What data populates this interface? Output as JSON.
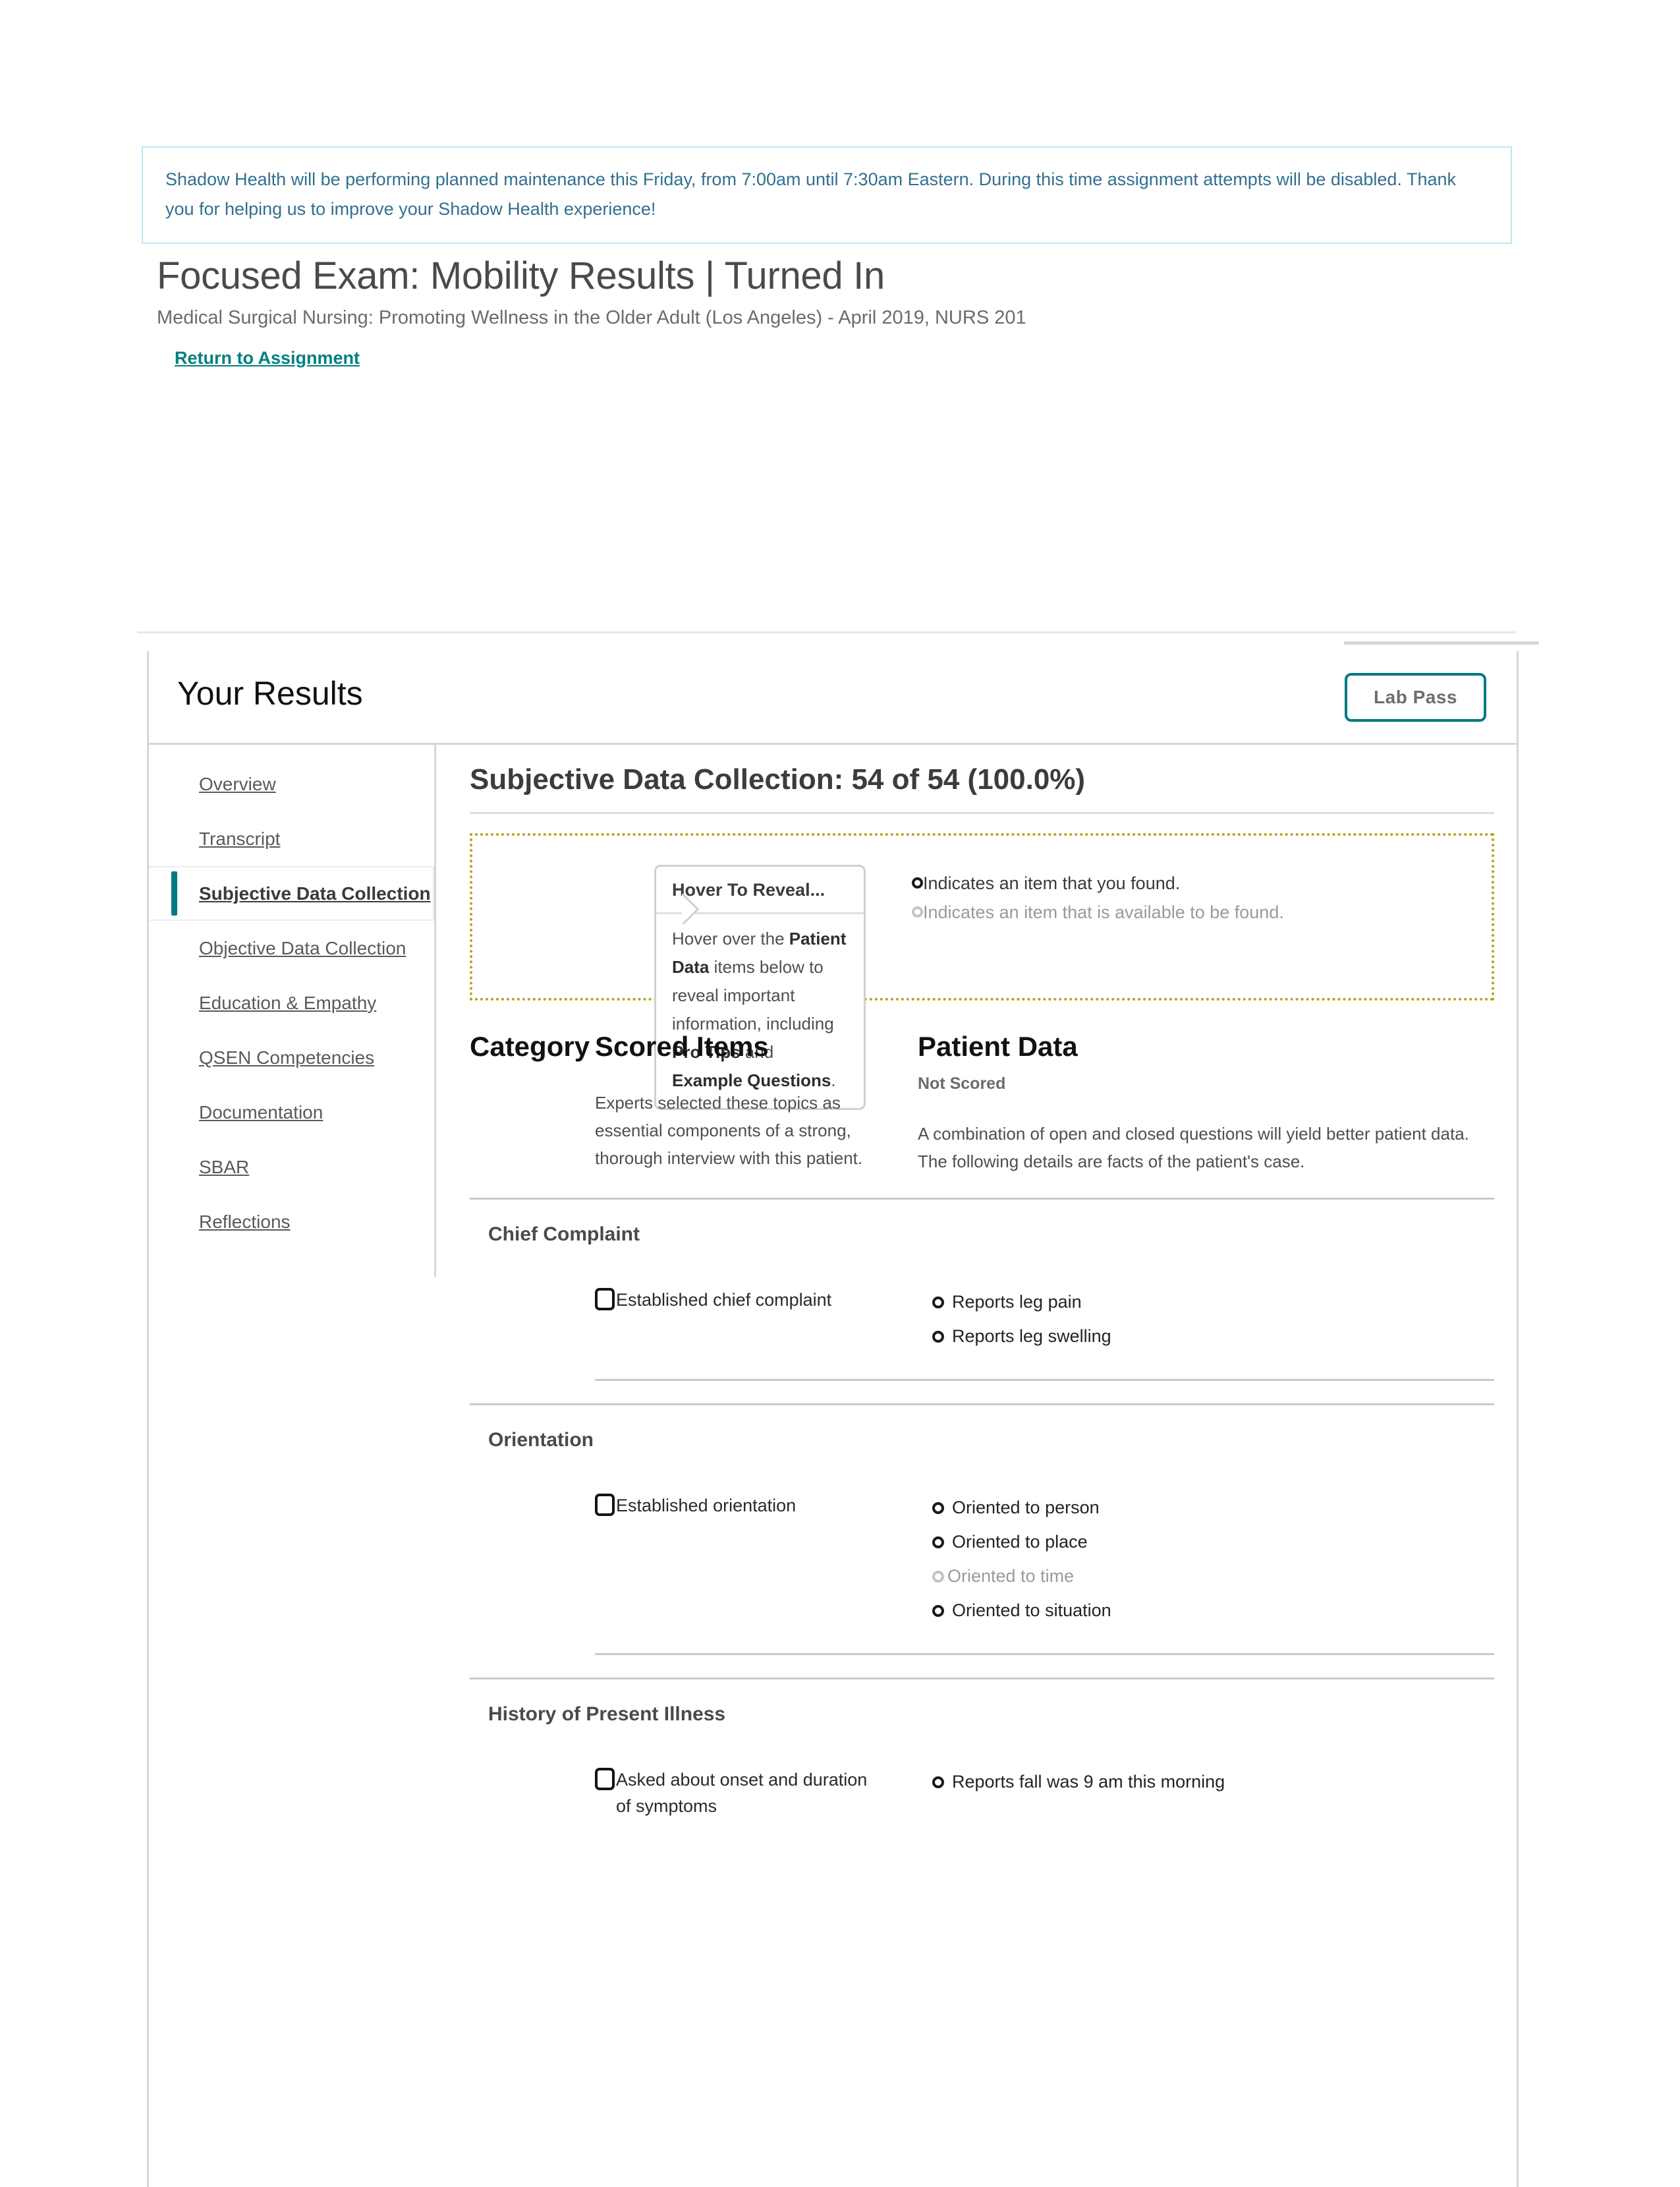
{
  "banner": {
    "text": "Shadow Health will be performing planned maintenance this Friday, from 7:00am until 7:30am Eastern. During this time assignment attempts will be disabled. Thank you for helping us to improve your Shadow Health experience!"
  },
  "header": {
    "title": "Focused Exam: Mobility Results | Turned In",
    "subtitle": "Medical Surgical Nursing: Promoting Wellness in the Older Adult (Los Angeles) - April 2019, NURS 201",
    "return_link": "Return to Assignment"
  },
  "results": {
    "title": "Your Results",
    "lab_pass_label": "Lab Pass"
  },
  "sidebar": {
    "items": [
      {
        "label": "Overview",
        "active": false
      },
      {
        "label": "Transcript",
        "active": false
      },
      {
        "label": "Subjective Data Collection",
        "active": true
      },
      {
        "label": "Objective Data Collection",
        "active": false
      },
      {
        "label": "Education & Empathy",
        "active": false
      },
      {
        "label": "QSEN Competencies",
        "active": false
      },
      {
        "label": "Documentation",
        "active": false
      },
      {
        "label": "SBAR",
        "active": false
      },
      {
        "label": "Reflections",
        "active": false
      }
    ]
  },
  "main": {
    "section_title": "Subjective Data Collection: 54 of 54 (100.0%)",
    "hover_card": {
      "title": "Hover To Reveal...",
      "body_parts": [
        {
          "text": "Hover over the ",
          "bold": false
        },
        {
          "text": "Patient Data",
          "bold": true
        },
        {
          "text": " items below to reveal important information, including ",
          "bold": false
        },
        {
          "text": "Pro Tips",
          "bold": true
        },
        {
          "text": " and ",
          "bold": false
        },
        {
          "text": "Example Questions",
          "bold": true
        },
        {
          "text": ".",
          "bold": false
        }
      ]
    },
    "legend": {
      "found": "Indicates an item that you found.",
      "available": "Indicates an item that is available to be found."
    },
    "columns": {
      "category_title": "Category",
      "scored_title": "Scored Items",
      "scored_desc": "Experts selected these topics as essential components of a strong, thorough interview with this patient.",
      "patient_title": "Patient Data",
      "patient_subtitle": "Not Scored",
      "patient_desc": "A combination of open and closed questions will yield better patient data. The following details are facts of the patient's case."
    },
    "sections": [
      {
        "name": "Chief Complaint",
        "scored_items": [
          {
            "label": "Established chief complaint",
            "checked": false
          }
        ],
        "patient_data": [
          {
            "label": "Reports leg pain",
            "found": true
          },
          {
            "label": "Reports leg swelling",
            "found": true
          }
        ]
      },
      {
        "name": "Orientation",
        "scored_items": [
          {
            "label": "Established orientation",
            "checked": false
          }
        ],
        "patient_data": [
          {
            "label": "Oriented to person",
            "found": true
          },
          {
            "label": "Oriented to place",
            "found": true
          },
          {
            "label": "Oriented to time",
            "found": false
          },
          {
            "label": "Oriented to situation",
            "found": true
          }
        ]
      },
      {
        "name": "History of Present Illness",
        "scored_items": [
          {
            "label": "Asked about onset and duration of symptoms",
            "checked": false
          }
        ],
        "patient_data": [
          {
            "label": "Reports fall was 9 am this morning",
            "found": true
          }
        ]
      }
    ]
  },
  "colors": {
    "accent_teal": "#007a81",
    "link_teal": "#00807f",
    "banner_border": "#bce8f1",
    "banner_text": "#31708f",
    "legend_border": "#b5a50a"
  }
}
